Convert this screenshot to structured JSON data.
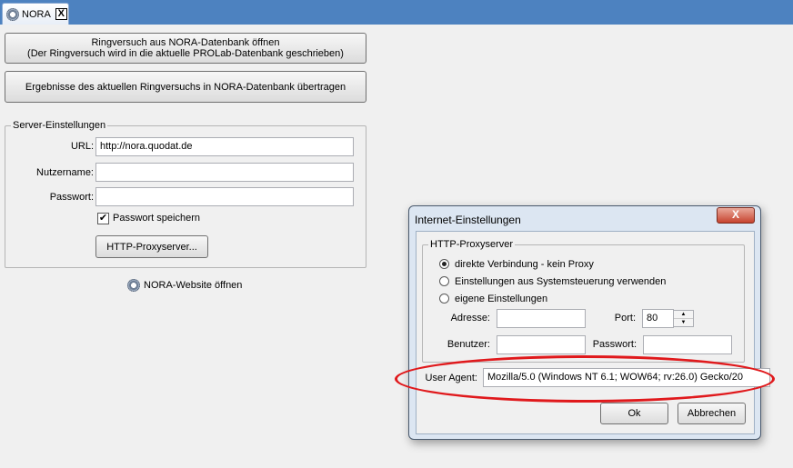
{
  "tab": {
    "label": "NORA",
    "close": "X"
  },
  "main": {
    "open_button": {
      "line1": "Ringversuch aus NORA-Datenbank öffnen",
      "line2": "(Der Ringversuch wird in die aktuelle PROLab-Datenbank geschrieben)"
    },
    "transfer_button": "Ergebnisse des aktuellen Ringversuchs in NORA-Datenbank übertragen",
    "server": {
      "legend": "Server-Einstellungen",
      "url_label": "URL:",
      "url_value": "http://nora.quodat.de",
      "user_label": "Nutzername:",
      "user_value": "",
      "password_label": "Passwort:",
      "password_value": "",
      "save_password_label": "Passwort speichern",
      "save_password_checked": true,
      "proxy_button": "HTTP-Proxyserver..."
    },
    "website_link": "NORA-Website öffnen"
  },
  "dialog": {
    "title": "Internet-Einstellungen",
    "close": "X",
    "proxy_legend": "HTTP-Proxyserver",
    "options": [
      "direkte Verbindung - kein Proxy",
      "Einstellungen aus Systemsteuerung verwenden",
      "eigene Einstellungen"
    ],
    "selected_option": 0,
    "address_label": "Adresse:",
    "address_value": "",
    "port_label": "Port:",
    "port_value": "80",
    "user_label": "Benutzer:",
    "user_value": "",
    "password_label": "Passwort:",
    "password_value": "",
    "user_agent_label": "User Agent:",
    "user_agent_value": "Mozilla/5.0 (Windows NT 6.1; WOW64; rv:26.0) Gecko/20",
    "ok": "Ok",
    "cancel": "Abbrechen"
  },
  "colors": {
    "tabstrip": "#4d82c0",
    "highlight_ellipse": "#e0191c"
  }
}
